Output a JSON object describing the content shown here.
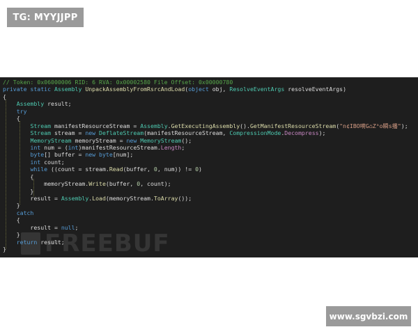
{
  "badges": {
    "tg": "TG: MYYJJPP",
    "site": "www.sgvbzi.com"
  },
  "watermark": {
    "text": "FREEBUF"
  },
  "code_lines": [
    [
      {
        "t": "// Token: 0x06000006 RID: 6 RVA: 0x00002580 File Offset: 0x00000780",
        "c": "com"
      }
    ],
    [
      {
        "t": "private static ",
        "c": "kw"
      },
      {
        "t": "Assembly ",
        "c": "type"
      },
      {
        "t": "UnpackAssemblyFromRsrcAndLoad",
        "c": "meth"
      },
      {
        "t": "(",
        "c": "plain"
      },
      {
        "t": "object ",
        "c": "kw"
      },
      {
        "t": "obj, ",
        "c": "plain"
      },
      {
        "t": "ResolveEventArgs ",
        "c": "type"
      },
      {
        "t": "resolveEventArgs)",
        "c": "plain"
      }
    ],
    [
      {
        "t": "{",
        "c": "plain"
      }
    ],
    [
      {
        "t": "    ",
        "c": "plain"
      },
      {
        "t": "Assembly ",
        "c": "type"
      },
      {
        "t": "result;",
        "c": "plain"
      }
    ],
    [
      {
        "t": "    ",
        "c": "plain"
      },
      {
        "t": "try",
        "c": "kw"
      }
    ],
    [
      {
        "t": "    {",
        "c": "plain"
      }
    ],
    [
      {
        "t": "        ",
        "c": "plain"
      },
      {
        "t": "Stream ",
        "c": "type"
      },
      {
        "t": "manifestResourceStream = ",
        "c": "plain"
      },
      {
        "t": "Assembly",
        "c": "type"
      },
      {
        "t": ".",
        "c": "plain"
      },
      {
        "t": "GetExecutingAssembly",
        "c": "meth"
      },
      {
        "t": "().",
        "c": "plain"
      },
      {
        "t": "GetManifestResourceStream",
        "c": "meth"
      },
      {
        "t": "(",
        "c": "plain"
      },
      {
        "t": "\"n¢IBO嗬G⌂Zᵃo瞬s播\"",
        "c": "str"
      },
      {
        "t": ");",
        "c": "plain"
      }
    ],
    [
      {
        "t": "        ",
        "c": "plain"
      },
      {
        "t": "Stream ",
        "c": "type"
      },
      {
        "t": "stream = ",
        "c": "plain"
      },
      {
        "t": "new ",
        "c": "kw"
      },
      {
        "t": "DeflateStream",
        "c": "type"
      },
      {
        "t": "(manifestResourceStream, ",
        "c": "plain"
      },
      {
        "t": "CompressionMode",
        "c": "type"
      },
      {
        "t": ".",
        "c": "plain"
      },
      {
        "t": "Decompress",
        "c": "prop"
      },
      {
        "t": ");",
        "c": "plain"
      }
    ],
    [
      {
        "t": "        ",
        "c": "plain"
      },
      {
        "t": "MemoryStream ",
        "c": "type"
      },
      {
        "t": "memoryStream = ",
        "c": "plain"
      },
      {
        "t": "new ",
        "c": "kw"
      },
      {
        "t": "MemoryStream",
        "c": "type"
      },
      {
        "t": "();",
        "c": "plain"
      }
    ],
    [
      {
        "t": "        ",
        "c": "plain"
      },
      {
        "t": "int ",
        "c": "kw"
      },
      {
        "t": "num = (",
        "c": "plain"
      },
      {
        "t": "int",
        "c": "kw"
      },
      {
        "t": ")manifestResourceStream.",
        "c": "plain"
      },
      {
        "t": "Length",
        "c": "prop"
      },
      {
        "t": ";",
        "c": "plain"
      }
    ],
    [
      {
        "t": "        ",
        "c": "plain"
      },
      {
        "t": "byte",
        "c": "kw"
      },
      {
        "t": "[] buffer = ",
        "c": "plain"
      },
      {
        "t": "new ",
        "c": "kw"
      },
      {
        "t": "byte",
        "c": "kw"
      },
      {
        "t": "[num];",
        "c": "plain"
      }
    ],
    [
      {
        "t": "        ",
        "c": "plain"
      },
      {
        "t": "int ",
        "c": "kw"
      },
      {
        "t": "count;",
        "c": "plain"
      }
    ],
    [
      {
        "t": "        ",
        "c": "plain"
      },
      {
        "t": "while ",
        "c": "kw"
      },
      {
        "t": "((count = stream.",
        "c": "plain"
      },
      {
        "t": "Read",
        "c": "meth"
      },
      {
        "t": "(buffer, ",
        "c": "plain"
      },
      {
        "t": "0",
        "c": "num"
      },
      {
        "t": ", num)) != ",
        "c": "plain"
      },
      {
        "t": "0",
        "c": "num"
      },
      {
        "t": ")",
        "c": "plain"
      }
    ],
    [
      {
        "t": "        {",
        "c": "plain"
      }
    ],
    [
      {
        "t": "            memoryStream.",
        "c": "plain"
      },
      {
        "t": "Write",
        "c": "meth"
      },
      {
        "t": "(buffer, ",
        "c": "plain"
      },
      {
        "t": "0",
        "c": "num"
      },
      {
        "t": ", count);",
        "c": "plain"
      }
    ],
    [
      {
        "t": "        }",
        "c": "plain"
      }
    ],
    [
      {
        "t": "        result = ",
        "c": "plain"
      },
      {
        "t": "Assembly",
        "c": "type"
      },
      {
        "t": ".",
        "c": "plain"
      },
      {
        "t": "Load",
        "c": "meth"
      },
      {
        "t": "(memoryStream.",
        "c": "plain"
      },
      {
        "t": "ToArray",
        "c": "meth"
      },
      {
        "t": "());",
        "c": "plain"
      }
    ],
    [
      {
        "t": "    }",
        "c": "plain"
      }
    ],
    [
      {
        "t": "    ",
        "c": "plain"
      },
      {
        "t": "catch",
        "c": "kw"
      }
    ],
    [
      {
        "t": "    {",
        "c": "plain"
      }
    ],
    [
      {
        "t": "        result = ",
        "c": "plain"
      },
      {
        "t": "null",
        "c": "kw"
      },
      {
        "t": ";",
        "c": "plain"
      }
    ],
    [
      {
        "t": "    }",
        "c": "plain"
      }
    ],
    [
      {
        "t": "    ",
        "c": "plain"
      },
      {
        "t": "return ",
        "c": "kw"
      },
      {
        "t": "result;",
        "c": "plain"
      }
    ],
    [
      {
        "t": "}",
        "c": "plain"
      }
    ]
  ]
}
